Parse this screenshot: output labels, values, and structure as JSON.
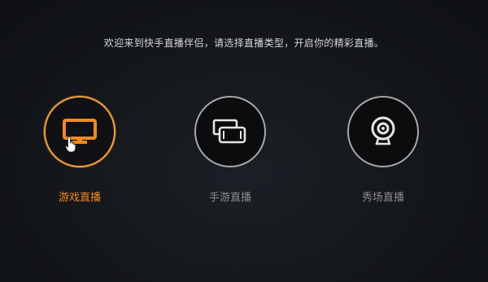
{
  "welcome_text": "欢迎来到快手直播伴侣，请选择直播类型，开启你的精彩直播。",
  "options": [
    {
      "label": "游戏直播",
      "icon": "monitor-icon",
      "active": true
    },
    {
      "label": "手游直播",
      "icon": "devices-icon",
      "active": false
    },
    {
      "label": "秀场直播",
      "icon": "webcam-icon",
      "active": false
    }
  ],
  "colors": {
    "accent": "#f08a24",
    "ring_active": "#f0a03c",
    "ring_inactive": "#a8a8a8",
    "label_inactive": "#8c8c8c",
    "background": "#15181c"
  }
}
